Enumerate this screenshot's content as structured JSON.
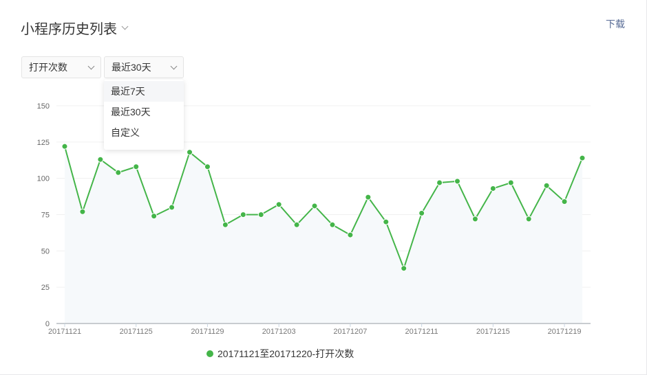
{
  "header": {
    "title": "小程序历史列表",
    "download": "下载"
  },
  "filters": {
    "metric": "打开次数",
    "range": "最近30天",
    "range_options": [
      "最近7天",
      "最近30天",
      "自定义"
    ]
  },
  "chart_data": {
    "type": "line",
    "x": [
      "20171121",
      "20171122",
      "20171123",
      "20171124",
      "20171125",
      "20171126",
      "20171127",
      "20171128",
      "20171129",
      "20171130",
      "20171201",
      "20171202",
      "20171203",
      "20171204",
      "20171205",
      "20171206",
      "20171207",
      "20171208",
      "20171209",
      "20171210",
      "20171211",
      "20171212",
      "20171213",
      "20171214",
      "20171215",
      "20171216",
      "20171217",
      "20171218",
      "20171219",
      "20171220"
    ],
    "series": [
      {
        "name": "20171121至20171220-打开次数",
        "values": [
          122,
          77,
          113,
          104,
          108,
          74,
          80,
          118,
          108,
          68,
          75,
          75,
          82,
          68,
          81,
          68,
          61,
          87,
          70,
          38,
          76,
          97,
          98,
          72,
          93,
          97,
          72,
          95,
          84,
          114
        ],
        "color": "#44b549"
      }
    ],
    "yticks": [
      "0",
      "25",
      "50",
      "75",
      "100",
      "125",
      "150"
    ],
    "xticks": [
      "20171121",
      "20171125",
      "20171129",
      "20171203",
      "20171207",
      "20171211",
      "20171215",
      "20171219"
    ],
    "ylim": [
      0,
      150
    ],
    "legend": "bottom-center",
    "grid": true
  }
}
